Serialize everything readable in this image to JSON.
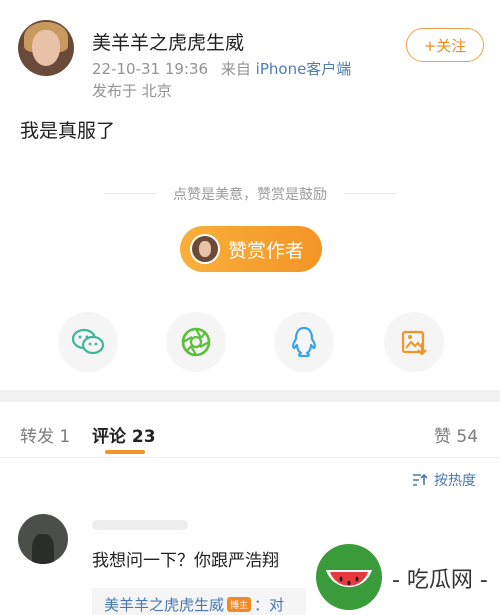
{
  "post": {
    "author": "美羊羊之虎虎生威",
    "time": "22-10-31 19:36",
    "source_prefix": "来自",
    "source": "iPhone客户端",
    "location": "发布于 北京",
    "follow_label": "+关注",
    "text": "我是真服了"
  },
  "reward": {
    "tip": "点赞是美意，赞赏是鼓励",
    "button_label": "赞赏作者"
  },
  "share": {
    "icons": [
      "wechat-icon",
      "moments-icon",
      "qq-icon",
      "save-image-icon"
    ]
  },
  "tabs": {
    "repost": "转发 1",
    "comments": "评论 23",
    "likes": "赞 54"
  },
  "sort": {
    "label": "按热度"
  },
  "comment": {
    "text": "我想问一下？你跟严浩翔",
    "reply_author": "美羊羊之虎虎生威",
    "reply_badge": "博主",
    "reply_snippet": "：对"
  },
  "watermark": {
    "text": "- 吃瓜网 -"
  },
  "colors": {
    "accent": "#f39426",
    "link": "#4a78b0",
    "muted": "#939393"
  }
}
